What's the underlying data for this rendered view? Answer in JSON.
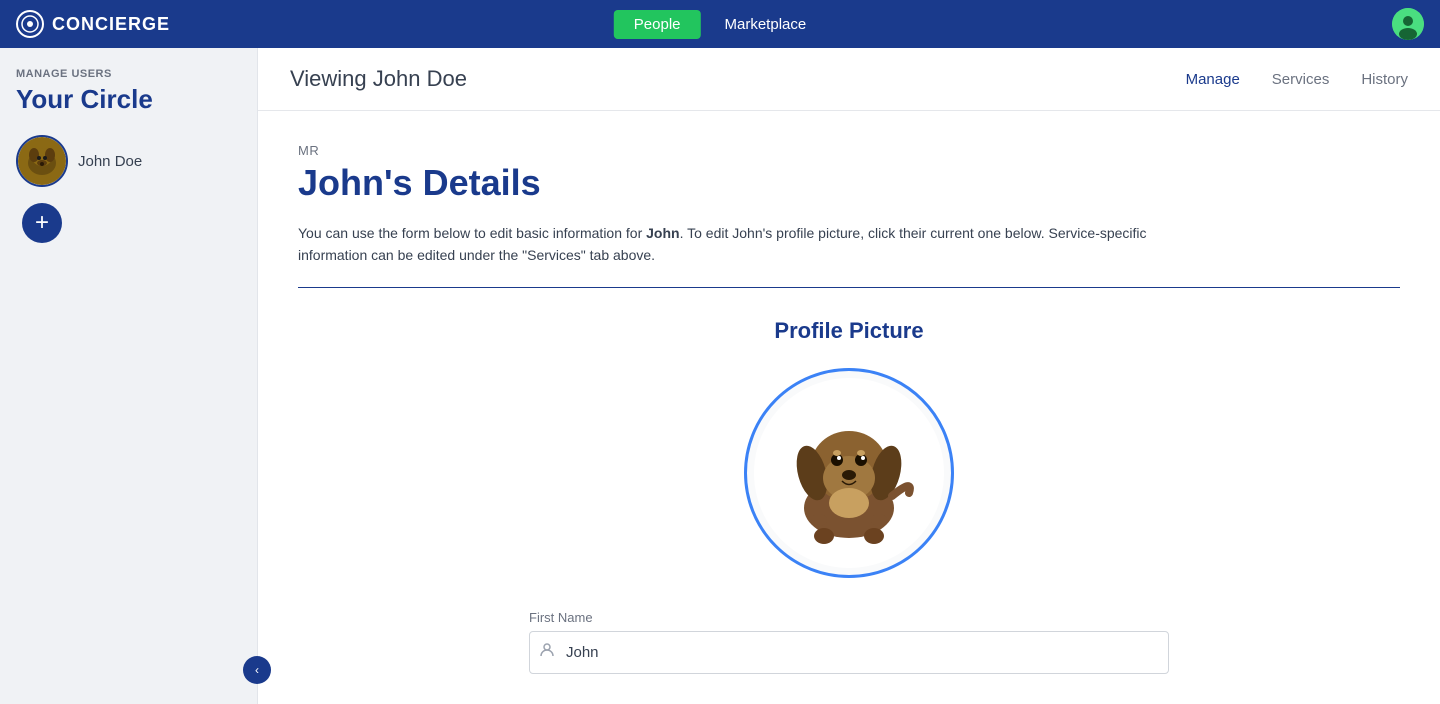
{
  "nav": {
    "logo_text": "CONCIERGE",
    "people_label": "People",
    "marketplace_label": "Marketplace"
  },
  "sidebar": {
    "manage_label": "MANAGE USERS",
    "circle_title": "Your Circle",
    "user_name": "John Doe",
    "add_button_label": "+"
  },
  "header": {
    "viewing_text": "Viewing John Doe",
    "tab_manage": "Manage",
    "tab_services": "Services",
    "tab_history": "History"
  },
  "content": {
    "salutation": "MR",
    "details_title": "John's Details",
    "description_part1": "You can use the form below to edit basic information for ",
    "description_bold": "John",
    "description_part2": ". To edit John's profile picture, click their current one below. Service-specific information can be edited under the \"Services\" tab above.",
    "profile_picture_label": "Profile Picture",
    "field_first_name_label": "First Name",
    "field_first_name_value": "John"
  },
  "colors": {
    "navy": "#1a3a8c",
    "green": "#22c55e",
    "blue_border": "#3b82f6"
  }
}
